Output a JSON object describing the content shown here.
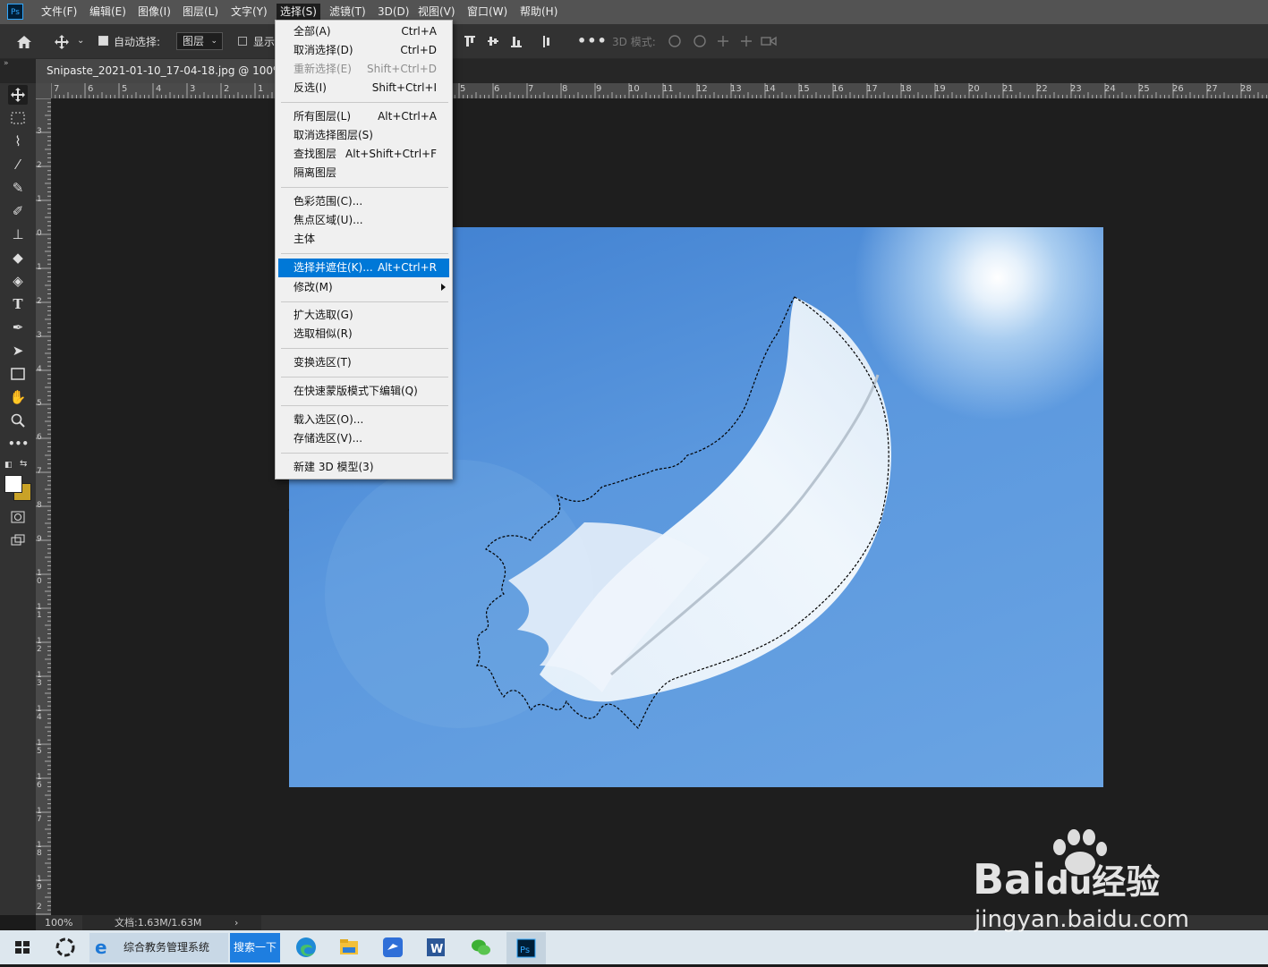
{
  "app": {
    "logo": "Ps"
  },
  "menubar": {
    "items": [
      "文件(F)",
      "编辑(E)",
      "图像(I)",
      "图层(L)",
      "文字(Y)",
      "选择(S)",
      "滤镜(T)",
      "3D(D)",
      "视图(V)",
      "窗口(W)",
      "帮助(H)"
    ],
    "active": "选择(S)"
  },
  "options": {
    "auto_select_label": "自动选择:",
    "auto_select_checked": true,
    "layer_dropdown": "图层",
    "show_label": "显示",
    "mode_3d_label": "3D 模式:"
  },
  "tab": {
    "title": "Snipaste_2021-01-10_17-04-18.jpg @ 100% (图"
  },
  "rulers": {
    "h_numbers": [
      "7",
      "6",
      "5",
      "4",
      "3",
      "2",
      "1",
      "5",
      "6",
      "7",
      "8",
      "9",
      "10",
      "11",
      "12",
      "13",
      "14",
      "15",
      "16",
      "17",
      "18",
      "19",
      "20",
      "21",
      "22",
      "23",
      "24",
      "25",
      "26",
      "27",
      "28"
    ],
    "v_numbers": [
      "3",
      "2",
      "1",
      "0",
      "1",
      "2",
      "3",
      "4",
      "5",
      "6",
      "7",
      "8",
      "9",
      "10",
      "11",
      "12",
      "13",
      "14",
      "15",
      "16",
      "17",
      "18",
      "19",
      "2"
    ]
  },
  "select_menu": {
    "items": [
      {
        "label": "全部(A)",
        "shortcut": "Ctrl+A"
      },
      {
        "label": "取消选择(D)",
        "shortcut": "Ctrl+D"
      },
      {
        "label": "重新选择(E)",
        "shortcut": "Shift+Ctrl+D",
        "disabled": true
      },
      {
        "label": "反选(I)",
        "shortcut": "Shift+Ctrl+I"
      },
      {
        "label": "所有图层(L)",
        "shortcut": "Alt+Ctrl+A"
      },
      {
        "label": "取消选择图层(S)",
        "shortcut": ""
      },
      {
        "label": "查找图层",
        "shortcut": "Alt+Shift+Ctrl+F"
      },
      {
        "label": "隔离图层",
        "shortcut": ""
      },
      {
        "label": "色彩范围(C)...",
        "shortcut": ""
      },
      {
        "label": "焦点区域(U)...",
        "shortcut": ""
      },
      {
        "label": "主体",
        "shortcut": ""
      },
      {
        "label": "选择并遮住(K)...",
        "shortcut": "Alt+Ctrl+R",
        "highlighted": true
      },
      {
        "label": "修改(M)",
        "shortcut": "",
        "submenu": true
      },
      {
        "label": "扩大选取(G)",
        "shortcut": ""
      },
      {
        "label": "选取相似(R)",
        "shortcut": ""
      },
      {
        "label": "变换选区(T)",
        "shortcut": ""
      },
      {
        "label": "在快速蒙版模式下编辑(Q)",
        "shortcut": ""
      },
      {
        "label": "载入选区(O)...",
        "shortcut": ""
      },
      {
        "label": "存储选区(V)...",
        "shortcut": ""
      },
      {
        "label": "新建 3D 模型(3)",
        "shortcut": ""
      }
    ]
  },
  "status": {
    "zoom": "100%",
    "doc": "文档:1.63M/1.63M"
  },
  "taskbar": {
    "ie_label": "综合教务管理系统",
    "search_label": "搜索一下"
  },
  "watermark": {
    "brand": "Bai",
    "brand2": "du",
    "cn": "经验",
    "url": "jingyan.baidu.com"
  },
  "colors": {
    "accent": "#0078d7",
    "ps_blue": "#31a8ff",
    "foreground": "#ffffff",
    "background": "#c9a227"
  }
}
